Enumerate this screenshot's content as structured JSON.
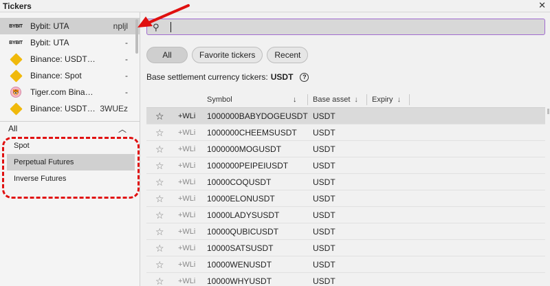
{
  "window": {
    "title": "Tickers"
  },
  "exchanges": [
    {
      "logo": "BYBIT",
      "logo_type": "bybit",
      "name": "Bybit: UTA",
      "account": "npljl",
      "selected": true
    },
    {
      "logo": "BYBIT",
      "logo_type": "bybit",
      "name": "Bybit: UTA",
      "account": "-",
      "selected": false
    },
    {
      "logo": "",
      "logo_type": "binance",
      "name": "Binance: USDT…",
      "account": "-",
      "selected": false
    },
    {
      "logo": "",
      "logo_type": "binance",
      "name": "Binance: Spot",
      "account": "-",
      "selected": false
    },
    {
      "logo": "",
      "logo_type": "tiger",
      "name": "Tiger.com Bina…",
      "account": "-",
      "selected": false
    },
    {
      "logo": "",
      "logo_type": "binance",
      "name": "Binance: USDT…",
      "account": "3WUEz",
      "selected": false
    }
  ],
  "categories": {
    "header": "All",
    "items": [
      {
        "label": "Spot",
        "selected": false
      },
      {
        "label": "Perpetual Futures",
        "selected": true
      },
      {
        "label": "Inverse Futures",
        "selected": false
      }
    ]
  },
  "search": {
    "value": "",
    "placeholder": ""
  },
  "filters": [
    {
      "label": "All",
      "active": true
    },
    {
      "label": "Favorite tickers",
      "active": false
    },
    {
      "label": "Recent",
      "active": false
    }
  ],
  "settlement": {
    "label": "Base settlement currency tickers:",
    "currency": "USDT"
  },
  "table": {
    "columns": [
      "Symbol",
      "Base asset",
      "Expiry"
    ],
    "wli_label": "+WLi",
    "rows": [
      {
        "symbol": "1000000BABYDOGEUSDT",
        "base": "USDT"
      },
      {
        "symbol": "1000000CHEEMSUSDT",
        "base": "USDT"
      },
      {
        "symbol": "1000000MOGUSDT",
        "base": "USDT"
      },
      {
        "symbol": "1000000PEIPEIUSDT",
        "base": "USDT"
      },
      {
        "symbol": "10000COQUSDT",
        "base": "USDT"
      },
      {
        "symbol": "10000ELONUSDT",
        "base": "USDT"
      },
      {
        "symbol": "10000LADYSUSDT",
        "base": "USDT"
      },
      {
        "symbol": "10000QUBICUSDT",
        "base": "USDT"
      },
      {
        "symbol": "10000SATSUSDT",
        "base": "USDT"
      },
      {
        "symbol": "10000WENUSDT",
        "base": "USDT"
      },
      {
        "symbol": "10000WHYUSDT",
        "base": "USDT"
      }
    ]
  },
  "colors": {
    "annotation": "#e01010",
    "search_focus": "#a06bd0",
    "binance": "#f0b90b"
  }
}
